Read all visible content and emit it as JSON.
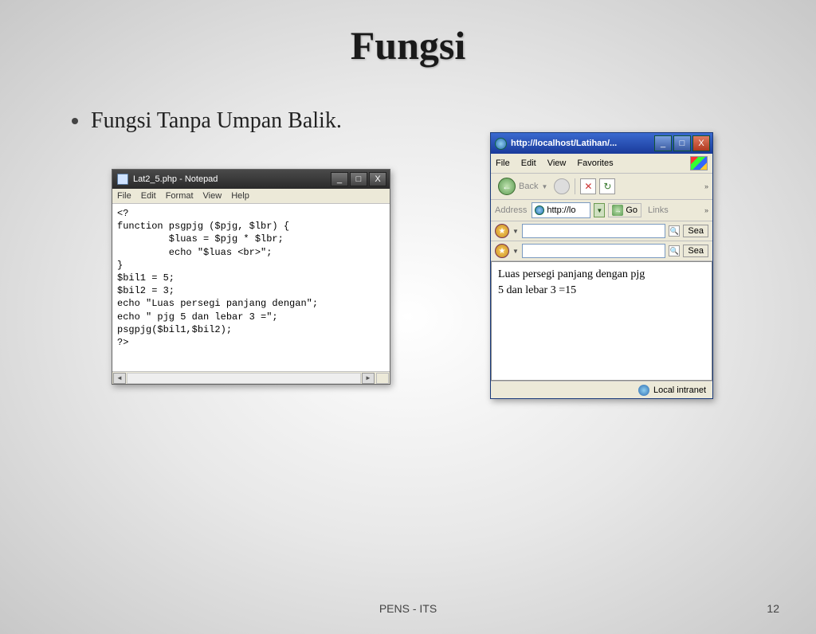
{
  "slide": {
    "title": "Fungsi",
    "bullet": "Fungsi Tanpa Umpan Balik.",
    "footer": "PENS - ITS",
    "page": "12"
  },
  "notepad": {
    "title": "Lat2_5.php - Notepad",
    "menu": {
      "file": "File",
      "edit": "Edit",
      "format": "Format",
      "view": "View",
      "help": "Help"
    },
    "win": {
      "min": "_",
      "max": "□",
      "close": "X"
    },
    "code": "<?\nfunction psgpjg ($pjg, $lbr) {\n         $luas = $pjg * $lbr;\n         echo \"$luas <br>\";\n}\n$bil1 = 5;\n$bil2 = 3;\necho \"Luas persegi panjang dengan\";\necho \" pjg 5 dan lebar 3 =\";\npsgpjg($bil1,$bil2);\n?>"
  },
  "ie": {
    "title": "http://localhost/Latihan/...",
    "menu": {
      "file": "File",
      "edit": "Edit",
      "view": "View",
      "favorites": "Favorites"
    },
    "win": {
      "min": "_",
      "max": "□",
      "close": "X"
    },
    "toolbar": {
      "back": "Back",
      "chevron": "»"
    },
    "address": {
      "label": "Address",
      "url": "http://lo",
      "go": "Go",
      "links": "Links",
      "chevron": "»"
    },
    "searchbars": {
      "sea": "Sea"
    },
    "output_l1": "Luas persegi panjang dengan pjg",
    "output_l2": "5 dan lebar 3 =15",
    "status": "Local intranet"
  }
}
